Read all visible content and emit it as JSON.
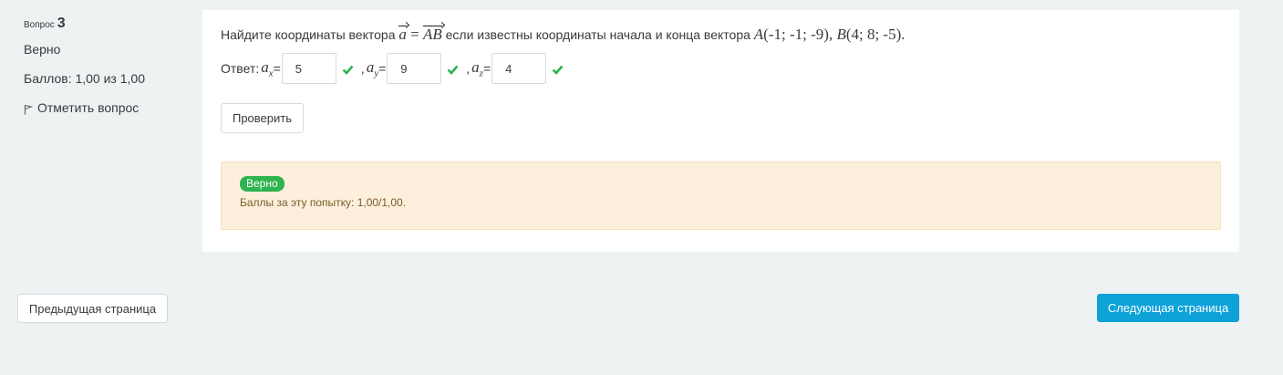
{
  "question_info": {
    "label": "Вопрос",
    "number": "3",
    "state": "Верно",
    "grade": "Баллов: 1,00 из 1,00",
    "flag_label": "Отметить вопрос"
  },
  "question": {
    "text_before": "Найдите координаты вектора",
    "vector_a": "a",
    "equals": " = ",
    "vector_ab": "AB",
    "text_after": " если известны координаты начала и конца вектора ",
    "point_a": "A",
    "point_a_coords": "(-1; -1; -9),",
    "point_b": " B",
    "point_b_coords": "(4; 8; -5)."
  },
  "answer": {
    "label": "Ответ:",
    "comma": ",",
    "eq": "=",
    "var": "a",
    "fields": [
      {
        "sub": "x",
        "value": "5"
      },
      {
        "sub": "y",
        "value": "9"
      },
      {
        "sub": "z",
        "value": "4"
      }
    ]
  },
  "buttons": {
    "check": "Проверить",
    "prev": "Предыдущая страница",
    "next": "Следующая страница"
  },
  "feedback": {
    "badge": "Верно",
    "score": "Баллы за эту попытку: 1,00/1,00."
  },
  "colors": {
    "correct": "#2eb34e",
    "primary": "#0ea2d9",
    "feedback_bg": "#fcefdc",
    "page_bg": "#eff2f3"
  },
  "icons": {
    "flag": "flag-icon",
    "check": "check-icon"
  }
}
